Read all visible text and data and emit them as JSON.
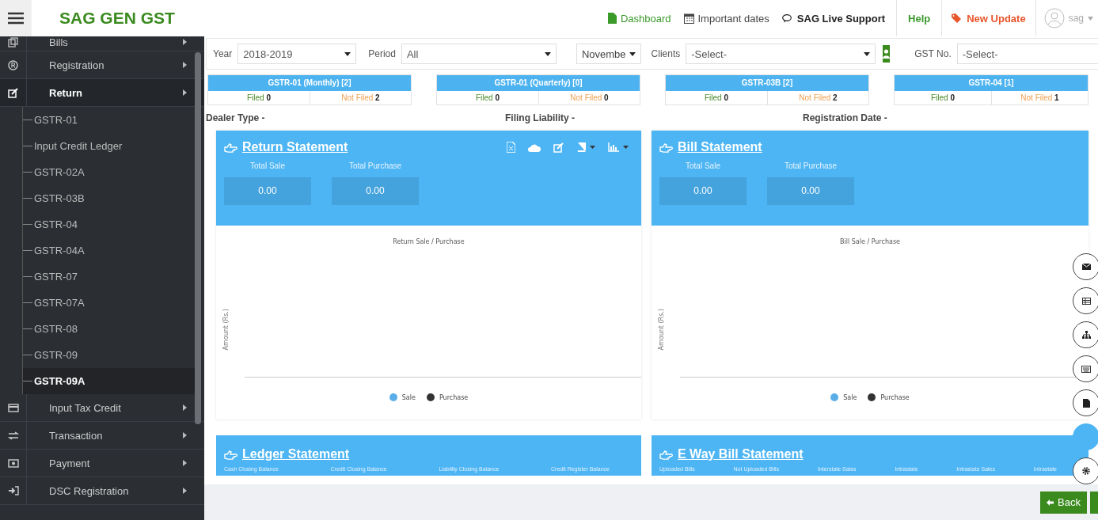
{
  "app": {
    "title": "SAG GEN GST"
  },
  "topbar": {
    "links": [
      {
        "kind": "dashboard",
        "label": "Dashboard"
      },
      {
        "kind": "dates",
        "label": "Important dates"
      },
      {
        "kind": "support",
        "label": "SAG Live Support"
      },
      {
        "kind": "help",
        "label": "Help"
      },
      {
        "kind": "update",
        "label": "New Update"
      }
    ],
    "user": "sag"
  },
  "sidebar": {
    "items": [
      {
        "label": "Bills",
        "kind": "bills",
        "selected": false
      },
      {
        "label": "Registration",
        "kind": "registered",
        "selected": false
      },
      {
        "label": "Return",
        "kind": "edit",
        "selected": true,
        "children": [
          {
            "label": "GSTR-01",
            "selected": false
          },
          {
            "label": "Input Credit Ledger",
            "selected": false
          },
          {
            "label": "GSTR-02A",
            "selected": false
          },
          {
            "label": "GSTR-03B",
            "selected": false
          },
          {
            "label": "GSTR-04",
            "selected": false
          },
          {
            "label": "GSTR-04A",
            "selected": false
          },
          {
            "label": "GSTR-07",
            "selected": false
          },
          {
            "label": "GSTR-07A",
            "selected": false
          },
          {
            "label": "GSTR-08",
            "selected": false
          },
          {
            "label": "GSTR-09",
            "selected": false
          },
          {
            "label": "GSTR-09A",
            "selected": true
          }
        ]
      },
      {
        "label": "Input Tax Credit",
        "kind": "card",
        "selected": false
      },
      {
        "label": "Transaction",
        "kind": "exchange",
        "selected": false
      },
      {
        "label": "Payment",
        "kind": "money",
        "selected": false
      },
      {
        "label": "DSC Registration",
        "kind": "signin",
        "selected": false
      }
    ]
  },
  "filters": {
    "year": {
      "label": "Year",
      "value": "2018-2019"
    },
    "period": {
      "label": "Period",
      "value": "All"
    },
    "month": "Novembe",
    "clients": {
      "label": "Clients",
      "value": "-Select-"
    },
    "gst_no": {
      "label": "GST No.",
      "value": "-Select-"
    }
  },
  "status_cards": [
    {
      "title": "GSTR-01 (Monthly) [2]",
      "filed_label": "Filed",
      "filed": "0",
      "not_filed_label": "Not Filed",
      "not_filed": "2"
    },
    {
      "title": "GSTR-01 (Quarterly) [0]",
      "filed_label": "Filed",
      "filed": "0",
      "not_filed_label": "Not Filed",
      "not_filed": "0"
    },
    {
      "title": "GSTR-03B [2]",
      "filed_label": "Filed",
      "filed": "0",
      "not_filed_label": "Not Filed",
      "not_filed": "2"
    },
    {
      "title": "GSTR-04 [1]",
      "filed_label": "Filed",
      "filed": "0",
      "not_filed_label": "Not Filed",
      "not_filed": "1"
    }
  ],
  "info": [
    "Dealer Type -",
    "Filing Liability -",
    "Registration Date -"
  ],
  "statements": [
    {
      "title": "Return Statement",
      "toolbar": true,
      "stats": [
        {
          "label": "Total Sale",
          "value": "0.00"
        },
        {
          "label": "Total Purchase",
          "value": "0.00"
        }
      ],
      "chart": {
        "title": "Return Sale / Purchase",
        "ylabel": "Amount (Rs.)",
        "legend": [
          {
            "label": "Sale",
            "color": "#5aaee8"
          },
          {
            "label": "Purchase",
            "color": "#333333"
          }
        ]
      }
    },
    {
      "title": "Bill Statement",
      "toolbar": false,
      "stats": [
        {
          "label": "Total Sale",
          "value": "0.00"
        },
        {
          "label": "Total Purchase",
          "value": "0.00"
        }
      ],
      "chart": {
        "title": "Bill Sale / Purchase",
        "ylabel": "Amount (Rs.)",
        "legend": [
          {
            "label": "Sale",
            "color": "#5aaee8"
          },
          {
            "label": "Purchase",
            "color": "#333333"
          }
        ]
      }
    }
  ],
  "lower_statements": [
    {
      "title": "Ledger Statement",
      "columns": [
        "Cash Closing Balance",
        "Credit Closing Balance",
        "Liability Closing Balance",
        "Credit Register Balance"
      ]
    },
    {
      "title": "E Way Bill Statement",
      "columns": [
        "Uploaded Bills",
        "Not Uploaded Bills",
        "Interstate Sales",
        "Intrastate",
        "Intrastate Sales",
        "Intrastate"
      ]
    }
  ],
  "side_tools": [
    {
      "kind": "mail"
    },
    {
      "kind": "table"
    },
    {
      "kind": "sitemap"
    },
    {
      "kind": "keyboard"
    },
    {
      "kind": "file"
    },
    {
      "kind": "blank"
    },
    {
      "kind": "gear"
    }
  ],
  "footer": {
    "back": "Back"
  }
}
